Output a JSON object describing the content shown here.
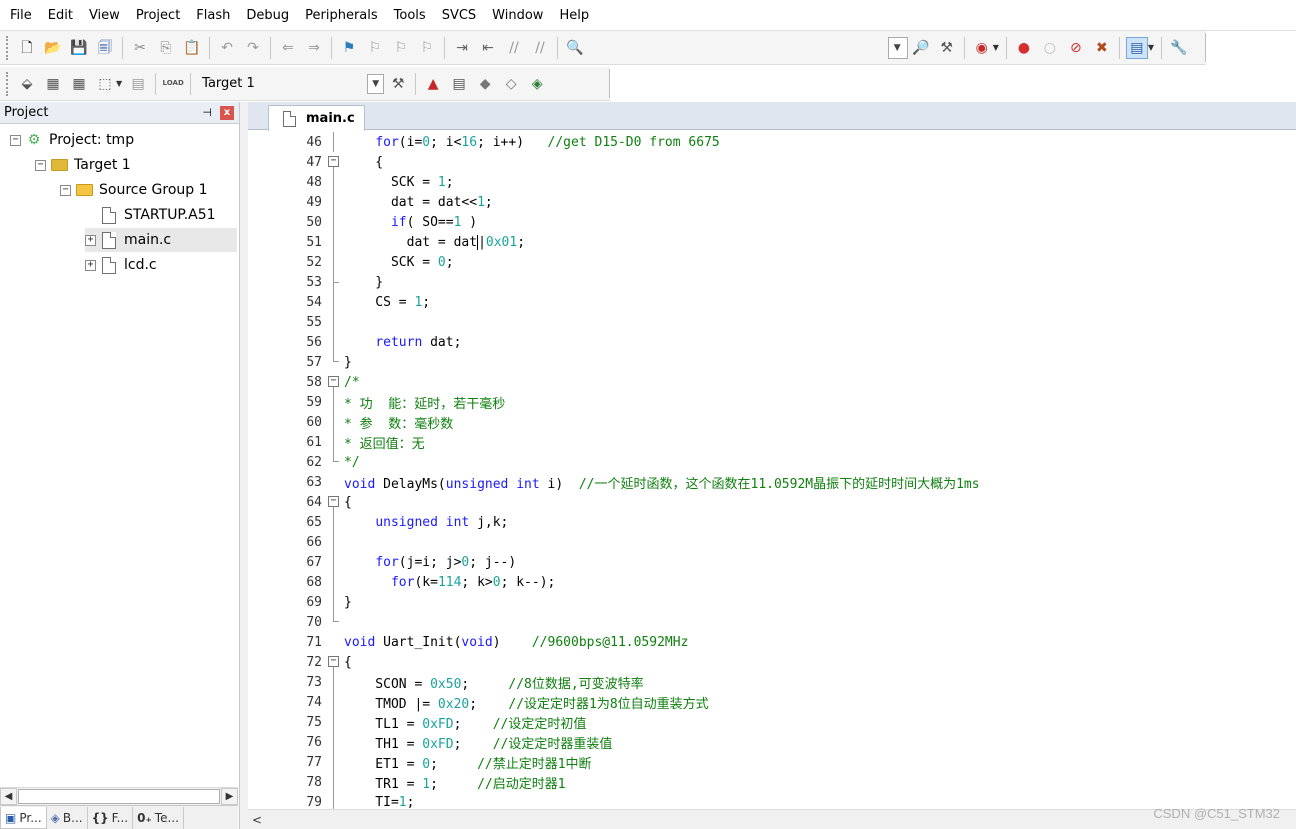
{
  "menu": [
    "File",
    "Edit",
    "View",
    "Project",
    "Flash",
    "Debug",
    "Peripherals",
    "Tools",
    "SVCS",
    "Window",
    "Help"
  ],
  "toolbar": {
    "target_label": "Target 1",
    "load_label": "LOAD"
  },
  "project_panel": {
    "title": "Project",
    "pin": "⊣",
    "close": "x",
    "tree": {
      "project": "Project: tmp",
      "target": "Target 1",
      "group": "Source Group 1",
      "files": [
        "STARTUP.A51",
        "main.c",
        "lcd.c"
      ]
    },
    "tabs": [
      "Pr...",
      "B...",
      "F...",
      "Te..."
    ],
    "tab_icons": [
      "▣",
      "◈",
      "{}",
      "0₊"
    ]
  },
  "editor": {
    "active_tab": "main.c",
    "lines": [
      {
        "n": "46",
        "fold": "line",
        "t": [
          [
            "    ",
            "pl"
          ],
          [
            "for",
            "kw"
          ],
          [
            "(i=",
            "pl"
          ],
          [
            "0",
            "num"
          ],
          [
            "; i<",
            "pl"
          ],
          [
            "16",
            "num"
          ],
          [
            "; i++)   ",
            "pl"
          ],
          [
            "//get D15-D0 from 6675",
            "cm"
          ]
        ]
      },
      {
        "n": "47",
        "fold": "box",
        "t": [
          [
            "    {",
            "pl"
          ]
        ]
      },
      {
        "n": "48",
        "fold": "line",
        "t": [
          [
            "      SCK = ",
            "pl"
          ],
          [
            "1",
            "num"
          ],
          [
            ";",
            "pl"
          ]
        ]
      },
      {
        "n": "49",
        "fold": "line",
        "t": [
          [
            "      dat = dat<<",
            "pl"
          ],
          [
            "1",
            "num"
          ],
          [
            ";",
            "pl"
          ]
        ]
      },
      {
        "n": "50",
        "fold": "line",
        "t": [
          [
            "      ",
            "pl"
          ],
          [
            "if",
            "kw"
          ],
          [
            "( SO==",
            "pl"
          ],
          [
            "1",
            "num"
          ],
          [
            " )",
            "pl"
          ]
        ]
      },
      {
        "n": "51",
        "fold": "line",
        "t": [
          [
            "        dat = dat",
            "pl"
          ],
          [
            "|",
            "cursor"
          ],
          [
            "0x01",
            "num"
          ],
          [
            ";",
            "pl"
          ]
        ]
      },
      {
        "n": "52",
        "fold": "line",
        "t": [
          [
            "      SCK = ",
            "pl"
          ],
          [
            "0",
            "num"
          ],
          [
            ";",
            "pl"
          ]
        ]
      },
      {
        "n": "53",
        "fold": "tick",
        "t": [
          [
            "    }",
            "pl"
          ]
        ]
      },
      {
        "n": "54",
        "fold": "line",
        "t": [
          [
            "    CS = ",
            "pl"
          ],
          [
            "1",
            "num"
          ],
          [
            ";",
            "pl"
          ]
        ]
      },
      {
        "n": "55",
        "fold": "line",
        "t": [
          [
            "",
            "pl"
          ]
        ]
      },
      {
        "n": "56",
        "fold": "line",
        "t": [
          [
            "    ",
            "pl"
          ],
          [
            "return",
            "kw"
          ],
          [
            " dat;",
            "pl"
          ]
        ]
      },
      {
        "n": "57",
        "fold": "end",
        "t": [
          [
            "}",
            "pl"
          ]
        ]
      },
      {
        "n": "58",
        "fold": "box",
        "t": [
          [
            "/*",
            "cm"
          ]
        ]
      },
      {
        "n": "59",
        "fold": "line",
        "t": [
          [
            "* 功  能：延时，若干毫秒",
            "cm"
          ]
        ]
      },
      {
        "n": "60",
        "fold": "line",
        "t": [
          [
            "* 参  数：毫秒数",
            "cm"
          ]
        ]
      },
      {
        "n": "61",
        "fold": "line",
        "t": [
          [
            "* 返回值：无",
            "cm"
          ]
        ]
      },
      {
        "n": "62",
        "fold": "end",
        "t": [
          [
            "*/",
            "cm"
          ]
        ]
      },
      {
        "n": "63",
        "fold": "none",
        "t": [
          [
            "void",
            "kw"
          ],
          [
            " DelayMs(",
            "pl"
          ],
          [
            "unsigned",
            "kw"
          ],
          [
            " ",
            "pl"
          ],
          [
            "int",
            "kw"
          ],
          [
            " i)  ",
            "pl"
          ],
          [
            "//一个延时函数，这个函数在11.0592M晶振下的延时时间大概为1ms",
            "cm"
          ]
        ]
      },
      {
        "n": "64",
        "fold": "box",
        "t": [
          [
            "{",
            "pl"
          ]
        ]
      },
      {
        "n": "65",
        "fold": "line",
        "t": [
          [
            "    ",
            "pl"
          ],
          [
            "unsigned",
            "kw"
          ],
          [
            " ",
            "pl"
          ],
          [
            "int",
            "kw"
          ],
          [
            " j,k;",
            "pl"
          ]
        ]
      },
      {
        "n": "66",
        "fold": "line",
        "t": [
          [
            "",
            "pl"
          ]
        ]
      },
      {
        "n": "67",
        "fold": "line",
        "t": [
          [
            "    ",
            "pl"
          ],
          [
            "for",
            "kw"
          ],
          [
            "(j=i; j>",
            "pl"
          ],
          [
            "0",
            "num"
          ],
          [
            "; j--)",
            "pl"
          ]
        ]
      },
      {
        "n": "68",
        "fold": "line",
        "t": [
          [
            "      ",
            "pl"
          ],
          [
            "for",
            "kw"
          ],
          [
            "(k=",
            "pl"
          ],
          [
            "114",
            "num"
          ],
          [
            "; k>",
            "pl"
          ],
          [
            "0",
            "num"
          ],
          [
            "; k--);",
            "pl"
          ]
        ]
      },
      {
        "n": "69",
        "fold": "line",
        "t": [
          [
            "}",
            "pl"
          ]
        ]
      },
      {
        "n": "70",
        "fold": "end",
        "t": [
          [
            "",
            "pl"
          ]
        ]
      },
      {
        "n": "71",
        "fold": "none",
        "t": [
          [
            "void",
            "kw"
          ],
          [
            " Uart_Init(",
            "pl"
          ],
          [
            "void",
            "kw"
          ],
          [
            ")    ",
            "pl"
          ],
          [
            "//9600bps@11.0592MHz",
            "cm"
          ]
        ]
      },
      {
        "n": "72",
        "fold": "box",
        "t": [
          [
            "{",
            "pl"
          ]
        ]
      },
      {
        "n": "73",
        "fold": "line",
        "t": [
          [
            "    SCON = ",
            "pl"
          ],
          [
            "0x50",
            "num"
          ],
          [
            ";     ",
            "pl"
          ],
          [
            "//8位数据,可变波特率",
            "cm"
          ]
        ]
      },
      {
        "n": "74",
        "fold": "line",
        "t": [
          [
            "    TMOD |= ",
            "pl"
          ],
          [
            "0x20",
            "num"
          ],
          [
            ";    ",
            "pl"
          ],
          [
            "//设定定时器1为8位自动重装方式",
            "cm"
          ]
        ]
      },
      {
        "n": "75",
        "fold": "line",
        "t": [
          [
            "    TL1 = ",
            "pl"
          ],
          [
            "0xFD",
            "num"
          ],
          [
            ";    ",
            "pl"
          ],
          [
            "//设定定时初值",
            "cm"
          ]
        ]
      },
      {
        "n": "76",
        "fold": "line",
        "t": [
          [
            "    TH1 = ",
            "pl"
          ],
          [
            "0xFD",
            "num"
          ],
          [
            ";    ",
            "pl"
          ],
          [
            "//设定定时器重装值",
            "cm"
          ]
        ]
      },
      {
        "n": "77",
        "fold": "line",
        "t": [
          [
            "    ET1 = ",
            "pl"
          ],
          [
            "0",
            "num"
          ],
          [
            ";     ",
            "pl"
          ],
          [
            "//禁止定时器1中断",
            "cm"
          ]
        ]
      },
      {
        "n": "78",
        "fold": "line",
        "t": [
          [
            "    TR1 = ",
            "pl"
          ],
          [
            "1",
            "num"
          ],
          [
            ";     ",
            "pl"
          ],
          [
            "//启动定时器1",
            "cm"
          ]
        ]
      },
      {
        "n": "79",
        "fold": "line",
        "t": [
          [
            "    TI=",
            "pl"
          ],
          [
            "1",
            "num"
          ],
          [
            ";",
            "pl"
          ]
        ]
      }
    ]
  },
  "watermark": "CSDN @C51_STM32",
  "colors": {
    "keyword": "#1a1aff",
    "number": "#1aa39c",
    "comment": "#108010"
  }
}
